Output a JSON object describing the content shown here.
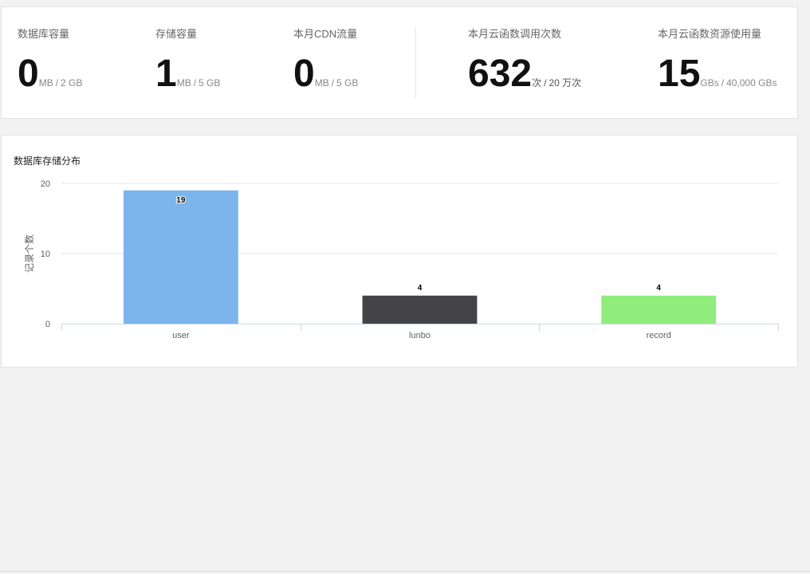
{
  "stats": [
    {
      "label": "数据库容量",
      "value": "0",
      "unit": "MB",
      "limit": "2 GB"
    },
    {
      "label": "存储容量",
      "value": "1",
      "unit": "MB",
      "limit": "5 GB"
    },
    {
      "label": "本月CDN流量",
      "value": "0",
      "unit": "MB",
      "limit": "5 GB"
    },
    {
      "label": "本月云函数调用次数",
      "value": "632",
      "unit": "次",
      "limit": "20 万次"
    },
    {
      "label": "本月云函数资源使用量",
      "value": "15",
      "unit": "GBs",
      "limit": "40,000 GBs"
    }
  ],
  "chart_card": {
    "title": "数据库存储分布"
  },
  "chart_data": {
    "type": "bar",
    "title": "数据库存储分布",
    "xlabel": "",
    "ylabel": "记录个数",
    "categories": [
      "user",
      "lunbo",
      "record"
    ],
    "values": [
      19,
      4,
      4
    ],
    "colors": [
      "#7cb5ec",
      "#434348",
      "#90ed7d"
    ],
    "ylim": [
      0,
      20
    ],
    "yticks": [
      "0",
      "10",
      "20"
    ],
    "grid": true,
    "data_labels": true
  }
}
